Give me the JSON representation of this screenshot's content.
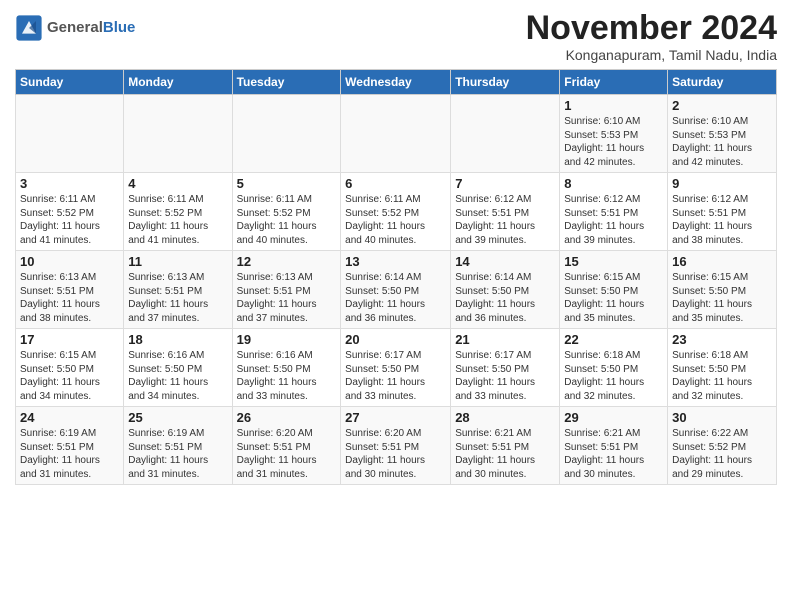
{
  "header": {
    "logo_line1": "General",
    "logo_line2": "Blue",
    "month_title": "November 2024",
    "subtitle": "Konganapuram, Tamil Nadu, India"
  },
  "weekdays": [
    "Sunday",
    "Monday",
    "Tuesday",
    "Wednesday",
    "Thursday",
    "Friday",
    "Saturday"
  ],
  "weeks": [
    [
      {
        "day": "",
        "info": ""
      },
      {
        "day": "",
        "info": ""
      },
      {
        "day": "",
        "info": ""
      },
      {
        "day": "",
        "info": ""
      },
      {
        "day": "",
        "info": ""
      },
      {
        "day": "1",
        "info": "Sunrise: 6:10 AM\nSunset: 5:53 PM\nDaylight: 11 hours\nand 42 minutes."
      },
      {
        "day": "2",
        "info": "Sunrise: 6:10 AM\nSunset: 5:53 PM\nDaylight: 11 hours\nand 42 minutes."
      }
    ],
    [
      {
        "day": "3",
        "info": "Sunrise: 6:11 AM\nSunset: 5:52 PM\nDaylight: 11 hours\nand 41 minutes."
      },
      {
        "day": "4",
        "info": "Sunrise: 6:11 AM\nSunset: 5:52 PM\nDaylight: 11 hours\nand 41 minutes."
      },
      {
        "day": "5",
        "info": "Sunrise: 6:11 AM\nSunset: 5:52 PM\nDaylight: 11 hours\nand 40 minutes."
      },
      {
        "day": "6",
        "info": "Sunrise: 6:11 AM\nSunset: 5:52 PM\nDaylight: 11 hours\nand 40 minutes."
      },
      {
        "day": "7",
        "info": "Sunrise: 6:12 AM\nSunset: 5:51 PM\nDaylight: 11 hours\nand 39 minutes."
      },
      {
        "day": "8",
        "info": "Sunrise: 6:12 AM\nSunset: 5:51 PM\nDaylight: 11 hours\nand 39 minutes."
      },
      {
        "day": "9",
        "info": "Sunrise: 6:12 AM\nSunset: 5:51 PM\nDaylight: 11 hours\nand 38 minutes."
      }
    ],
    [
      {
        "day": "10",
        "info": "Sunrise: 6:13 AM\nSunset: 5:51 PM\nDaylight: 11 hours\nand 38 minutes."
      },
      {
        "day": "11",
        "info": "Sunrise: 6:13 AM\nSunset: 5:51 PM\nDaylight: 11 hours\nand 37 minutes."
      },
      {
        "day": "12",
        "info": "Sunrise: 6:13 AM\nSunset: 5:51 PM\nDaylight: 11 hours\nand 37 minutes."
      },
      {
        "day": "13",
        "info": "Sunrise: 6:14 AM\nSunset: 5:50 PM\nDaylight: 11 hours\nand 36 minutes."
      },
      {
        "day": "14",
        "info": "Sunrise: 6:14 AM\nSunset: 5:50 PM\nDaylight: 11 hours\nand 36 minutes."
      },
      {
        "day": "15",
        "info": "Sunrise: 6:15 AM\nSunset: 5:50 PM\nDaylight: 11 hours\nand 35 minutes."
      },
      {
        "day": "16",
        "info": "Sunrise: 6:15 AM\nSunset: 5:50 PM\nDaylight: 11 hours\nand 35 minutes."
      }
    ],
    [
      {
        "day": "17",
        "info": "Sunrise: 6:15 AM\nSunset: 5:50 PM\nDaylight: 11 hours\nand 34 minutes."
      },
      {
        "day": "18",
        "info": "Sunrise: 6:16 AM\nSunset: 5:50 PM\nDaylight: 11 hours\nand 34 minutes."
      },
      {
        "day": "19",
        "info": "Sunrise: 6:16 AM\nSunset: 5:50 PM\nDaylight: 11 hours\nand 33 minutes."
      },
      {
        "day": "20",
        "info": "Sunrise: 6:17 AM\nSunset: 5:50 PM\nDaylight: 11 hours\nand 33 minutes."
      },
      {
        "day": "21",
        "info": "Sunrise: 6:17 AM\nSunset: 5:50 PM\nDaylight: 11 hours\nand 33 minutes."
      },
      {
        "day": "22",
        "info": "Sunrise: 6:18 AM\nSunset: 5:50 PM\nDaylight: 11 hours\nand 32 minutes."
      },
      {
        "day": "23",
        "info": "Sunrise: 6:18 AM\nSunset: 5:50 PM\nDaylight: 11 hours\nand 32 minutes."
      }
    ],
    [
      {
        "day": "24",
        "info": "Sunrise: 6:19 AM\nSunset: 5:51 PM\nDaylight: 11 hours\nand 31 minutes."
      },
      {
        "day": "25",
        "info": "Sunrise: 6:19 AM\nSunset: 5:51 PM\nDaylight: 11 hours\nand 31 minutes."
      },
      {
        "day": "26",
        "info": "Sunrise: 6:20 AM\nSunset: 5:51 PM\nDaylight: 11 hours\nand 31 minutes."
      },
      {
        "day": "27",
        "info": "Sunrise: 6:20 AM\nSunset: 5:51 PM\nDaylight: 11 hours\nand 30 minutes."
      },
      {
        "day": "28",
        "info": "Sunrise: 6:21 AM\nSunset: 5:51 PM\nDaylight: 11 hours\nand 30 minutes."
      },
      {
        "day": "29",
        "info": "Sunrise: 6:21 AM\nSunset: 5:51 PM\nDaylight: 11 hours\nand 30 minutes."
      },
      {
        "day": "30",
        "info": "Sunrise: 6:22 AM\nSunset: 5:52 PM\nDaylight: 11 hours\nand 29 minutes."
      }
    ]
  ]
}
